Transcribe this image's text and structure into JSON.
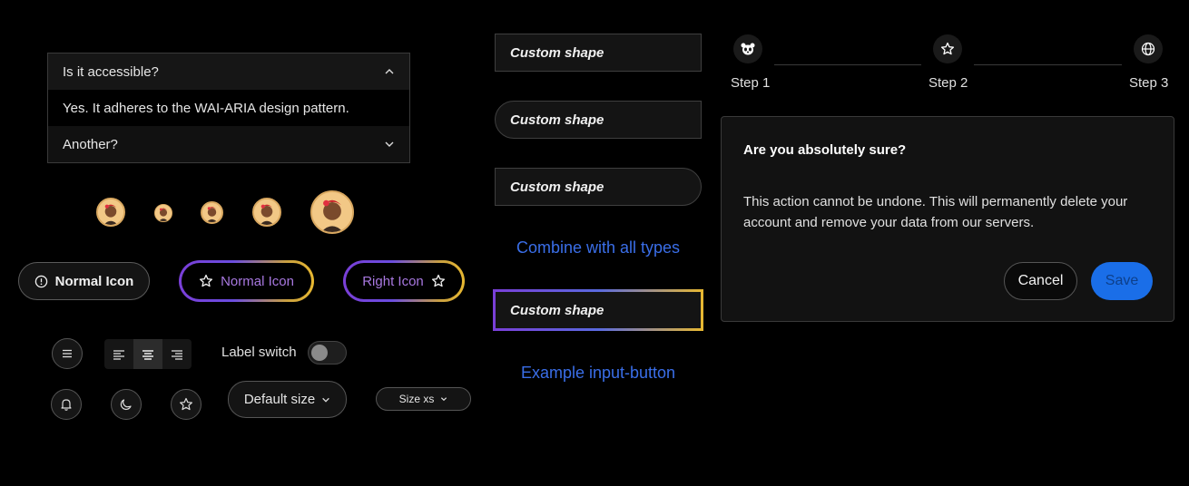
{
  "accordion": {
    "items": [
      {
        "title": "Is it accessible?",
        "content": "Yes. It adheres to the WAI-ARIA design pattern.",
        "expanded": true
      },
      {
        "title": "Another?",
        "expanded": false
      }
    ]
  },
  "avatars": {
    "count": 5,
    "icon": "avatar-portrait"
  },
  "icon_buttons": {
    "normal_left": "Normal Icon",
    "normal_gradient": "Normal Icon",
    "right_icon": "Right Icon"
  },
  "toolbar": {
    "menu_icon": "menu-icon",
    "align_options": [
      "align-left",
      "align-center",
      "align-right"
    ],
    "align_selected": "align-center",
    "switch_label": "Label switch",
    "switch_on": false,
    "bottom_icons": [
      "bell-icon",
      "moon-icon",
      "star-icon"
    ],
    "dropdown_default": "Default size",
    "dropdown_xs": "Size xs"
  },
  "shapes": {
    "label": "Custom shape",
    "combine_text": "Combine with all types",
    "example_text": "Example input-button"
  },
  "steps": [
    {
      "label": "Step 1",
      "icon": "panda-icon"
    },
    {
      "label": "Step 2",
      "icon": "star-icon"
    },
    {
      "label": "Step 3",
      "icon": "globe-icon"
    }
  ],
  "dialog": {
    "title": "Are you absolutely sure?",
    "body": "This action cannot be undone. This will permanently delete your account and remove your data from our servers.",
    "cancel": "Cancel",
    "save": "Save"
  },
  "colors": {
    "accent_blue": "#1a6ee8",
    "link_blue": "#3a6ee8",
    "gradient_purple": "#7a3fd8",
    "gradient_gold": "#e8b830"
  }
}
